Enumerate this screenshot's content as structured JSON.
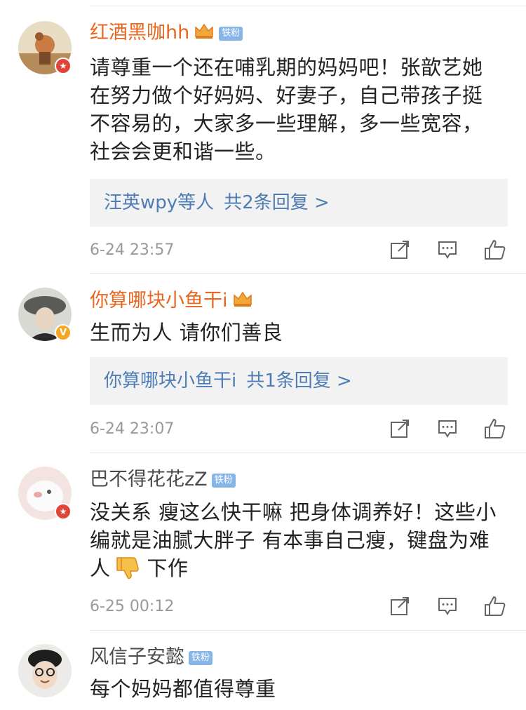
{
  "comments": [
    {
      "username": "红酒黑咖hh",
      "fan_badge": "铁粉",
      "text_lines": [
        "请尊重一个还在哺乳期的妈妈吧！张歆艺她",
        "在努力做个好妈妈、好妻子，自己带孩子挺",
        "不容易的，大家多一些理解，多一些宽容，",
        "社会会更和谐一些。"
      ],
      "reply_names": "汪英wpy等人",
      "reply_count": "共2条回复 >",
      "time": "6-24 23:57"
    },
    {
      "username": "你算哪块小鱼干i",
      "text_lines": [
        "生而为人 请你们善良"
      ],
      "reply_names": "你算哪块小鱼干i",
      "reply_count": "共1条回复 >",
      "time": "6-24 23:07"
    },
    {
      "username": "巴不得花花zZ",
      "fan_badge": "铁粉",
      "text_lines": [
        "没关系 瘦这么快干嘛 把身体调养好！这些小",
        "编就是油腻大胖子 有本事自己瘦，键盘为难",
        "下作"
      ],
      "time": "6-25 00:12"
    },
    {
      "username": "风信子安懿",
      "fan_badge": "铁粉",
      "text_lines": [
        "每个妈妈都值得尊重"
      ]
    }
  ],
  "text_word_prefix": "人",
  "icons": {
    "share": "share-icon",
    "comment": "comment-icon",
    "like": "thumbs-up-icon",
    "crown": "crown-icon",
    "thumbs_down": "thumbs-down-emoji"
  },
  "colors": {
    "vip_name": "#e8661f",
    "link": "#4e7db5",
    "fan_badge": "#87b5e8",
    "reply_bg": "#f2f2f2"
  }
}
